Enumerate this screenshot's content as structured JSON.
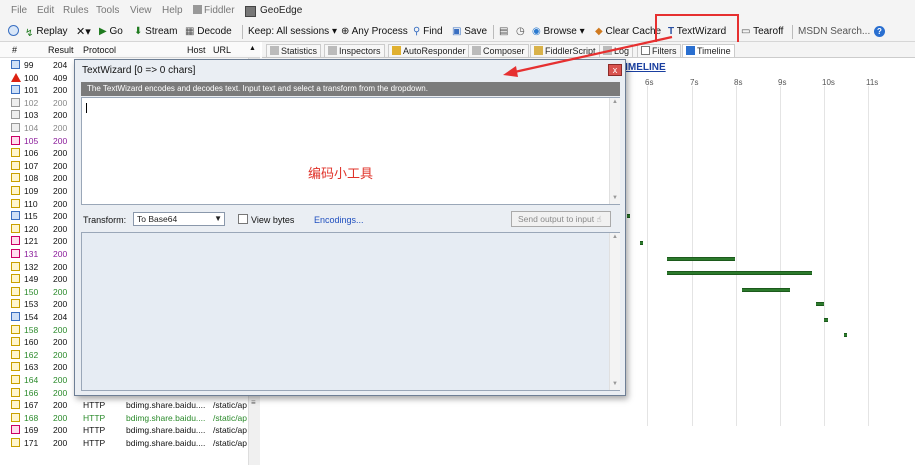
{
  "menu": {
    "items": [
      "File",
      "Edit",
      "Rules",
      "Tools",
      "View",
      "Help"
    ],
    "fiddler": "Fiddler",
    "geoedge": "GeoEdge"
  },
  "toolbar": {
    "replay": "Replay",
    "go": "Go",
    "stream": "Stream",
    "decode": "Decode",
    "keep": "Keep: All sessions",
    "any_process": "Any Process",
    "find": "Find",
    "save": "Save",
    "browse": "Browse",
    "clear_cache": "Clear Cache",
    "textwizard": "TextWizard",
    "tearoff": "Tearoff",
    "msdn_search": "MSDN Search..."
  },
  "sessions": {
    "headers": [
      "#",
      "Result",
      "Protocol",
      "Host",
      "URL"
    ],
    "rows": [
      {
        "id": "99",
        "result": "204",
        "protocol": "",
        "host": "",
        "url": "",
        "icon": "info",
        "color": "#111"
      },
      {
        "id": "100",
        "result": "409",
        "protocol": "",
        "host": "",
        "url": "",
        "icon": "warning",
        "color": "#111"
      },
      {
        "id": "101",
        "result": "200",
        "protocol": "",
        "host": "",
        "url": "",
        "icon": "arrows",
        "color": "#111"
      },
      {
        "id": "102",
        "result": "200",
        "protocol": "",
        "host": "",
        "url": "",
        "icon": "lock",
        "color": "#888"
      },
      {
        "id": "103",
        "result": "200",
        "protocol": "",
        "host": "",
        "url": "",
        "icon": "lock",
        "color": "#111"
      },
      {
        "id": "104",
        "result": "200",
        "protocol": "",
        "host": "",
        "url": "",
        "icon": "lock",
        "color": "#888"
      },
      {
        "id": "105",
        "result": "200",
        "protocol": "",
        "host": "",
        "url": "",
        "icon": "css",
        "color": "#8a1a9a"
      },
      {
        "id": "106",
        "result": "200",
        "protocol": "",
        "host": "",
        "url": "",
        "icon": "js",
        "color": "#111"
      },
      {
        "id": "107",
        "result": "200",
        "protocol": "",
        "host": "",
        "url": "",
        "icon": "js",
        "color": "#111"
      },
      {
        "id": "108",
        "result": "200",
        "protocol": "",
        "host": "",
        "url": "",
        "icon": "js",
        "color": "#111"
      },
      {
        "id": "109",
        "result": "200",
        "protocol": "",
        "host": "",
        "url": "",
        "icon": "js",
        "color": "#111"
      },
      {
        "id": "110",
        "result": "200",
        "protocol": "",
        "host": "",
        "url": "",
        "icon": "js",
        "color": "#111"
      },
      {
        "id": "115",
        "result": "200",
        "protocol": "",
        "host": "",
        "url": "",
        "icon": "arrows",
        "color": "#111"
      },
      {
        "id": "120",
        "result": "200",
        "protocol": "",
        "host": "",
        "url": "",
        "icon": "js",
        "color": "#111"
      },
      {
        "id": "121",
        "result": "200",
        "protocol": "",
        "host": "",
        "url": "",
        "icon": "html",
        "color": "#111"
      },
      {
        "id": "131",
        "result": "200",
        "protocol": "",
        "host": "",
        "url": "",
        "icon": "css",
        "color": "#8a1a9a"
      },
      {
        "id": "132",
        "result": "200",
        "protocol": "",
        "host": "",
        "url": "",
        "icon": "js",
        "color": "#111"
      },
      {
        "id": "149",
        "result": "200",
        "protocol": "",
        "host": "",
        "url": "",
        "icon": "js",
        "color": "#111"
      },
      {
        "id": "150",
        "result": "200",
        "protocol": "",
        "host": "",
        "url": "",
        "icon": "js",
        "color": "#2a8a2a"
      },
      {
        "id": "153",
        "result": "200",
        "protocol": "",
        "host": "",
        "url": "",
        "icon": "js",
        "color": "#111"
      },
      {
        "id": "154",
        "result": "204",
        "protocol": "",
        "host": "",
        "url": "",
        "icon": "info",
        "color": "#111"
      },
      {
        "id": "158",
        "result": "200",
        "protocol": "",
        "host": "",
        "url": "",
        "icon": "js",
        "color": "#2a8a2a"
      },
      {
        "id": "160",
        "result": "200",
        "protocol": "",
        "host": "",
        "url": "",
        "icon": "js",
        "color": "#111"
      },
      {
        "id": "162",
        "result": "200",
        "protocol": "",
        "host": "",
        "url": "",
        "icon": "js",
        "color": "#2a8a2a"
      },
      {
        "id": "163",
        "result": "200",
        "protocol": "",
        "host": "",
        "url": "",
        "icon": "js",
        "color": "#111"
      },
      {
        "id": "164",
        "result": "200",
        "protocol": "",
        "host": "",
        "url": "",
        "icon": "js",
        "color": "#2a8a2a"
      },
      {
        "id": "166",
        "result": "200",
        "protocol": "",
        "host": "",
        "url": "",
        "icon": "js",
        "color": "#2a8a2a"
      },
      {
        "id": "167",
        "result": "200",
        "protocol": "HTTP",
        "host": "bdimg.share.baidu....",
        "url": "/static/ap",
        "icon": "js",
        "color": "#111"
      },
      {
        "id": "168",
        "result": "200",
        "protocol": "HTTP",
        "host": "bdimg.share.baidu....",
        "url": "/static/ap",
        "icon": "js",
        "color": "#2a8a2a"
      },
      {
        "id": "169",
        "result": "200",
        "protocol": "HTTP",
        "host": "bdimg.share.baidu....",
        "url": "/static/ap",
        "icon": "html",
        "color": "#111"
      },
      {
        "id": "171",
        "result": "200",
        "protocol": "HTTP",
        "host": "bdimg.share.baidu....",
        "url": "/static/ap",
        "icon": "js",
        "color": "#111"
      }
    ]
  },
  "tabs": [
    "Statistics",
    "Inspectors",
    "AutoResponder",
    "Composer",
    "FiddlerScript",
    "Log",
    "Filters",
    "Timeline"
  ],
  "timeline": {
    "title": "TIMELINE",
    "ticks": [
      "6s",
      "7s",
      "8s",
      "9s",
      "10s",
      "11s"
    ]
  },
  "textwizard": {
    "title": "TextWizard [0 => 0 chars]",
    "close": "x",
    "description": "The TextWizard encodes and decodes text. Input text and select a transform from the dropdown.",
    "input_value": "",
    "annotation": "编码小工具",
    "transform_label": "Transform:",
    "transform_value": "To Base64",
    "view_bytes_label": "View bytes",
    "encodings_link": "Encodings...",
    "send_output_label": "Send output to input",
    "output_value": ""
  },
  "colors": {
    "highlight": "#e63030",
    "desc_bar": "#7b7b7b",
    "timeline_bar": "#2c7a2c"
  }
}
